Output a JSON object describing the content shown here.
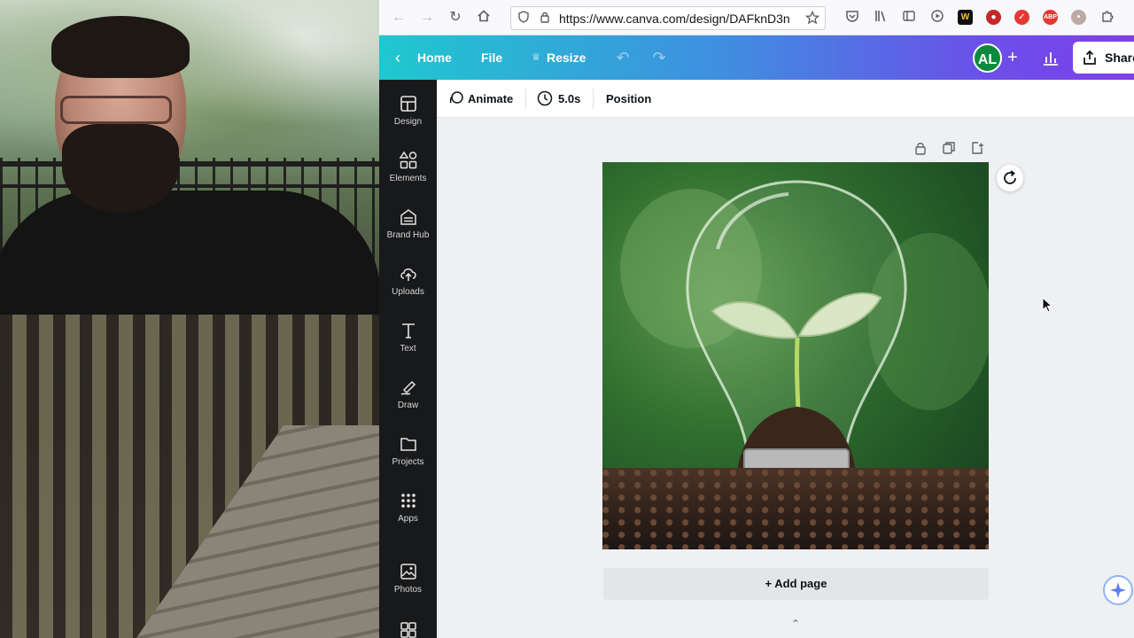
{
  "browser": {
    "url": "https://www.canva.com/design/DAFknD3n"
  },
  "header": {
    "home_label": "Home",
    "file_label": "File",
    "resize_label": "Resize",
    "avatar_initials": "AL",
    "share_label": "Share"
  },
  "sidebar": {
    "items": [
      {
        "label": "Design",
        "icon": "design-icon"
      },
      {
        "label": "Elements",
        "icon": "elements-icon"
      },
      {
        "label": "Brand Hub",
        "icon": "brand-hub-icon"
      },
      {
        "label": "Uploads",
        "icon": "uploads-icon"
      },
      {
        "label": "Text",
        "icon": "text-icon"
      },
      {
        "label": "Draw",
        "icon": "draw-icon"
      },
      {
        "label": "Projects",
        "icon": "projects-icon"
      },
      {
        "label": "Apps",
        "icon": "apps-icon"
      },
      {
        "label": "Photos",
        "icon": "photos-icon"
      }
    ]
  },
  "toolbar": {
    "animate_label": "Animate",
    "duration_label": "5.0s",
    "position_label": "Position"
  },
  "canvas": {
    "add_page_label": "+ Add page",
    "image_subject": "seedling-in-lightbulb-photo"
  },
  "colors": {
    "header_gradient_start": "#1fc8cf",
    "header_gradient_end": "#7f3fe8",
    "sidebar_bg": "#18191b",
    "avatar_bg": "#0b8a3e"
  }
}
